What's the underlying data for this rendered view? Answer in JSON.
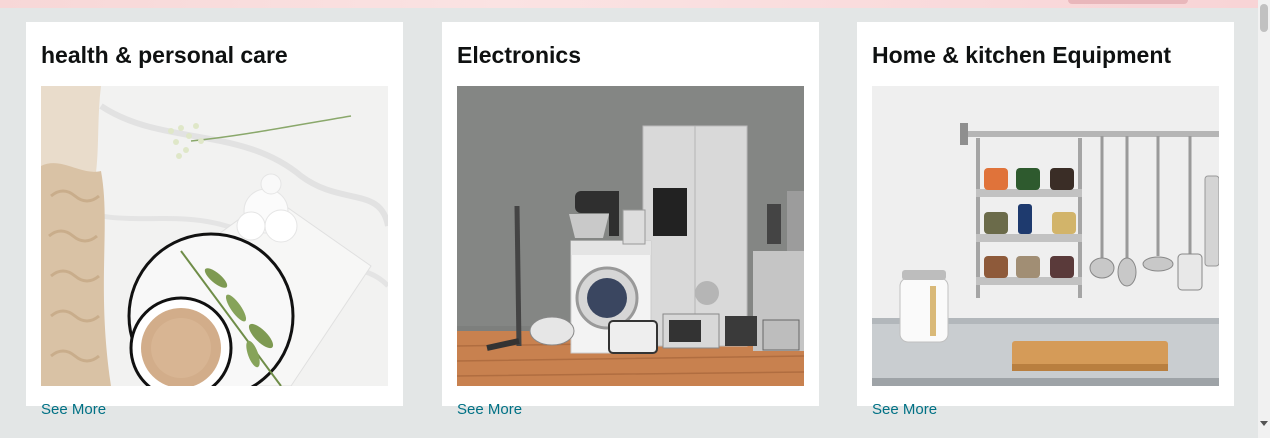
{
  "cards": [
    {
      "title": "health & personal care",
      "image_label": "coffee-and-towels-photo",
      "link": "See More"
    },
    {
      "title": "Electronics",
      "image_label": "home-appliances-photo",
      "link": "See More"
    },
    {
      "title": "Home & kitchen Equipment",
      "image_label": "kitchen-rack-photo",
      "link": "See More"
    }
  ],
  "colors": {
    "link": "#007185",
    "title": "#0f1111",
    "background": "#e3e6e6"
  }
}
